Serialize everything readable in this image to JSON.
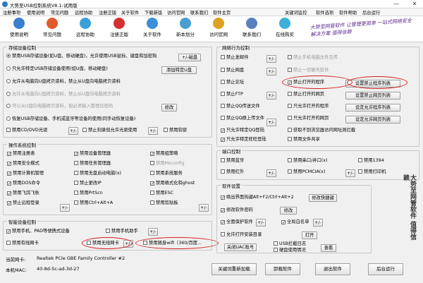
{
  "window": {
    "title": "大势至USB控制系统V8.1-试用版",
    "minimize": "—",
    "close": "✕"
  },
  "menu": [
    "注册事项",
    "使用说明",
    "常见问题",
    "远程协助",
    "注册正版",
    "关于软件",
    "下载新版",
    "访问官网",
    "联系我们",
    "软件主页",
    "关键词监控",
    "软件选项",
    "软件帮助",
    "后台运行"
  ],
  "toolbar": [
    {
      "label": "使用说明",
      "color": "#3a7fd0"
    },
    {
      "label": "常见问题",
      "color": "#e05a2a"
    },
    {
      "label": "远程协助",
      "color": "#3aa0d8"
    },
    {
      "label": "注册正版",
      "color": "#d43030"
    },
    {
      "label": "关于软件",
      "color": "#3a8fd8"
    },
    {
      "label": "新本划分",
      "color": "#4a9fd0"
    },
    {
      "label": "访问官网",
      "color": "#e0a020"
    },
    {
      "label": "联系我们",
      "color": "#5a7fc0"
    },
    {
      "label": "在线购买",
      "color": "#3cb0d8"
    }
  ],
  "slogan": "大势至网管软件 让管理更简单 一站式网络安全解决方案 值得信赖",
  "storage": {
    "title": "存储设备控制",
    "options": [
      "禁用USB存储设备(如U盘、移动硬盘)，允许使用USB鼠标、键盘和加密狗",
      "只允许特定USB存储设备使用(如U盘、移动硬盘)",
      "允许从电脑向U盘拷贝资料，禁止从U盘向电脑拷贝资料",
      "允许从电脑向U盘拷贝资料，禁止从U盘向电脑拷贝资料",
      "可以从U盘向电脑拷贝资料，但必须输入管理员密码",
      "恢复USB存储设备、手机或蓝牙等设备的使用(同手动恢复设备)"
    ],
    "plus_disk": "+/-磁盘",
    "add_udisk": "添加特定U盘",
    "modify": "修改",
    "cd_label": "禁用CD/DVD光驱",
    "burn_label": "禁止刻录但允许光驱使用",
    "floppy_label": "禁用软驱",
    "plus": "+/-"
  },
  "ops": {
    "title": "操作系统控制",
    "items": [
      [
        "禁用注册表",
        "禁用设备管理器",
        "禁用组策略"
      ],
      [
        "禁用安全模式",
        "禁用任务管理器",
        "禁用Msconfig"
      ],
      [
        "禁用计算机管理",
        "禁用无盘启动电脑(x)",
        "禁用系统服务"
      ],
      [
        "禁用DOS命令",
        "禁止更改IP",
        "禁用格式化和ghost"
      ],
      [
        "禁用飞鸽飞秋",
        "禁用PrtScn",
        "禁用ESC"
      ],
      [
        "禁止远程登录",
        "禁用Ctrl+Alt+A",
        "禁用剪贴板"
      ]
    ],
    "plus": "+/-"
  },
  "smart": {
    "title": "智能设备控制",
    "phone_pad": "禁用手机、PAD等便携式设备",
    "phone_assist": "禁用手机助手",
    "wifi_card": "禁用无线网卡",
    "portable_wifi": "禁用随身wifi（360/百度...",
    "camera": "禁用有线网卡",
    "plus": "+/-"
  },
  "network": {
    "title": "网络行为控制",
    "items": [
      [
        "禁止发邮件",
        "禁止手机电脑文件互传"
      ],
      [
        "禁止网盘",
        "禁止一切聊天软件"
      ],
      [
        "禁止论坛",
        "禁止打开的程序"
      ],
      [
        "禁止FTP",
        "禁止打开的网页"
      ],
      [
        "禁止QQ传送文件",
        "只允许打开的程序"
      ],
      [
        "禁止QQ群上传文件",
        "只允许打开的网页"
      ],
      [
        "只允许特定QQ登陆",
        "获取不到浏览器访问网址则拦截"
      ],
      [
        "只允许特定旺旺登陆",
        "禁用文件共享"
      ]
    ],
    "btn_set_prog": "设置禁止程序列表",
    "btn_set_web": "设置禁止网页列表",
    "btn_allow_prog": "设定允许程序列表",
    "btn_allow_web": "设定允许网页列表",
    "plus": "+/-"
  },
  "port": {
    "title": "端口控制",
    "items": [
      [
        "禁用蓝牙",
        "禁用串口/并口(x)",
        "禁用1394"
      ],
      [
        "禁用红外",
        "禁用PCMCIA(x)",
        "禁用打印机"
      ]
    ],
    "plus": "+/-"
  },
  "settings": {
    "title": "软件设置",
    "hotkey": "唤出界面热键Alt+F2/Ctrl+Alt+2",
    "hotkey_btn": "修改快捷键",
    "pwd": "修改软件密码",
    "pwd_btn": "修改",
    "protect": "全面保护软件",
    "whitelist": "全局白名单",
    "install": "允许打开安装目录",
    "open_btn": "打开",
    "uac_btn": "关闭UAC账号",
    "usb_log": "USB拦截日志",
    "usage": "硬盘使用情况",
    "view_btn": "查看",
    "plus": "+/-"
  },
  "side_slogan": "大势至网管软件 值得信赖",
  "info": {
    "nic_label": "当前网卡:",
    "nic_value": "Realtek PCIe GBE Family Controller #2",
    "mac_label": "本机MAC:",
    "mac_value": "40-8d-5c-ad-3d-27"
  },
  "bottom": [
    "关键词重新加载",
    "卸载软件",
    "退出软件",
    "后台运行"
  ]
}
